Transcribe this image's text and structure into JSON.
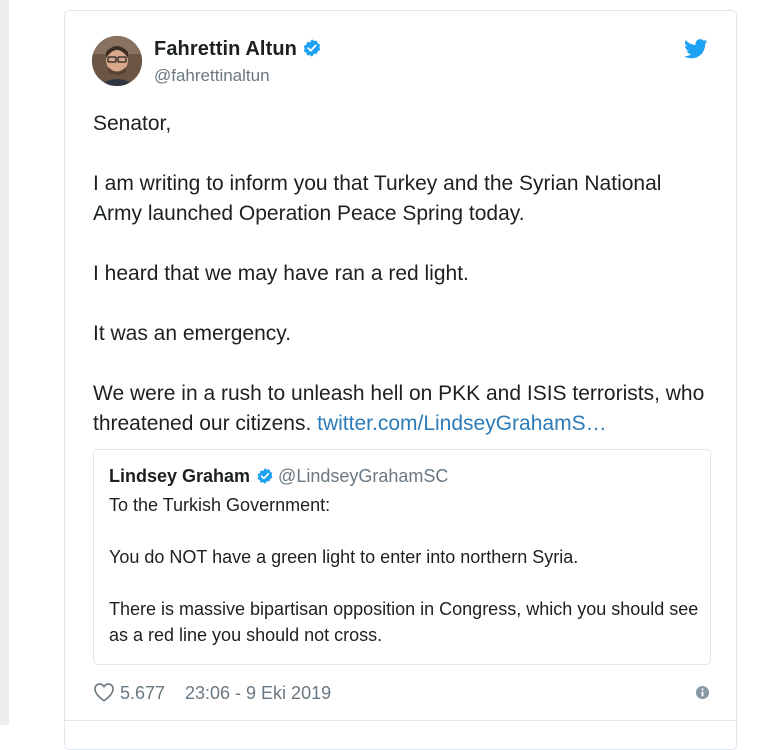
{
  "tweet": {
    "author_name": "Fahrettin Altun",
    "author_handle": "@fahrettinaltun",
    "paragraphs": [
      "Senator,",
      "I am writing to inform you that Turkey and the Syrian National Army launched Operation Peace Spring today.",
      "I heard that we may have ran a red light.",
      "It was an emergency.",
      "We were in a rush to unleash hell on PKK and ISIS terrorists, who threatened our citizens."
    ],
    "link_text": "twitter.com/LindseyGrahamS…",
    "likes": "5.677",
    "timestamp": "23:06 - 9 Eki 2019"
  },
  "quoted_tweet": {
    "author_name": "Lindsey Graham",
    "author_handle": "@LindseyGrahamSC",
    "paragraphs": [
      "To the Turkish Government:",
      "You do NOT have a green light to enter into northern Syria.",
      "There is massive bipartisan opposition in Congress, which you should see as a red line you should not cross."
    ]
  },
  "colors": {
    "text": "#1c2022",
    "secondary": "#697882",
    "link": "#2b7bb9",
    "verified": "#1da1f2",
    "twitter_blue": "#1da1f2",
    "border": "#e1e8ed"
  },
  "icons": {
    "verified": "verified-badge-icon",
    "twitter": "twitter-bird-icon",
    "like": "heart-icon",
    "info": "info-icon"
  }
}
